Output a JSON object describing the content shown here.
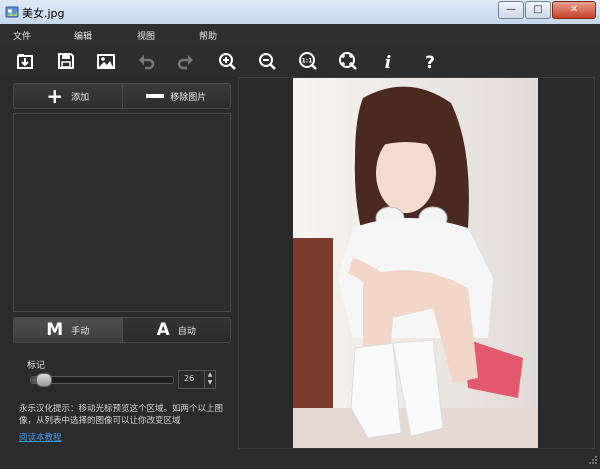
{
  "window": {
    "title": "美女.jpg",
    "close_glyph": "✕",
    "minimize_glyph": "—",
    "maximize_glyph": "□"
  },
  "menu": [
    {
      "label": "文件"
    },
    {
      "label": "编辑"
    },
    {
      "label": "视图"
    },
    {
      "label": "帮助"
    }
  ],
  "toolbar": [
    {
      "icon": "open-folder-icon"
    },
    {
      "icon": "save-icon"
    },
    {
      "icon": "image-icon"
    },
    {
      "icon": "undo-icon"
    },
    {
      "icon": "redo-icon"
    },
    {
      "icon": "zoom-in-icon"
    },
    {
      "icon": "zoom-out-icon"
    },
    {
      "icon": "zoom-actual-size-icon",
      "glyph": "1:1"
    },
    {
      "icon": "zoom-fit-icon"
    },
    {
      "icon": "info-icon",
      "glyph": "i"
    },
    {
      "icon": "help-icon",
      "glyph": "?"
    }
  ],
  "left": {
    "add_label": "添加",
    "remove_label": "移除图片",
    "mode_manual_letter": "M",
    "mode_manual_label": "手动",
    "mode_auto_letter": "A",
    "mode_auto_label": "自动",
    "marker_label": "标记",
    "marker_value": "26",
    "marker_level": 0.05,
    "hint": "永乐汉化提示：移动光标预览这个区域。如两个以上图像，从列表中选择的图像可以让你改变区域",
    "tutorial_link": "阅读本教程"
  },
  "colors": {
    "background": "#2b2b2b",
    "link": "#3d9be9",
    "title_bar": "#c6d7ec",
    "close_button": "#c7412a"
  }
}
